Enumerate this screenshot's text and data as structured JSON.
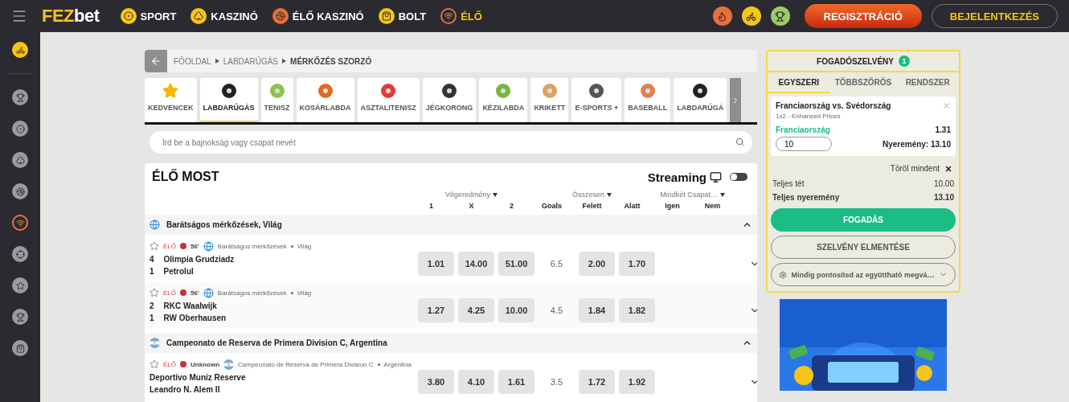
{
  "header": {
    "logo": {
      "accent": "FEZ",
      "rest": "bet"
    },
    "nav": [
      {
        "label": "SPORT",
        "selected": false
      },
      {
        "label": "KASZINÓ",
        "selected": false
      },
      {
        "label": "ÉLŐ KASZINÓ",
        "selected": false
      },
      {
        "label": "BOLT",
        "selected": false
      },
      {
        "label": "ÉLŐ",
        "selected": true
      }
    ],
    "register": "REGISZTRÁCIÓ",
    "login": "BEJELENTKEZÉS"
  },
  "sidebar": {
    "items": [
      {
        "selected": false
      },
      {
        "selected": false
      },
      {
        "selected": false
      },
      {
        "selected": false
      },
      {
        "selected": false
      },
      {
        "selected": true
      },
      {
        "selected": false
      },
      {
        "selected": false
      },
      {
        "selected": false
      },
      {
        "selected": false
      }
    ]
  },
  "breadcrumb": [
    "FŐOLDAL",
    "LABDARÚGÁS",
    "MÉRKŐZÉS SZORZÓ"
  ],
  "sports": [
    {
      "label": "KEDVENCEK",
      "selected": false
    },
    {
      "label": "LABDARÚGÁS",
      "selected": true
    },
    {
      "label": "TENISZ",
      "selected": false
    },
    {
      "label": "KOSÁRLABDA",
      "selected": false
    },
    {
      "label": "ASZTALITENISZ",
      "selected": false
    },
    {
      "label": "JÉGKORONG",
      "selected": false
    },
    {
      "label": "KÉZILABDA",
      "selected": false
    },
    {
      "label": "KRIKETT",
      "selected": false
    },
    {
      "label": "E-SPORTS +",
      "selected": false
    },
    {
      "label": "BASEBALL",
      "selected": false
    },
    {
      "label": "LABDARÚGÁ",
      "selected": false
    }
  ],
  "search": {
    "placeholder": "Írd be a bajnokság vagy csapat nevét"
  },
  "live": {
    "title": "ÉLŐ MOST",
    "streaming": {
      "label": "Streaming",
      "on": false
    },
    "markets": [
      {
        "label": "Végeredmény",
        "columns": [
          "1",
          "X",
          "2"
        ]
      },
      {
        "label": "Összesen",
        "columns": [
          "Goals",
          "Felett",
          "Alatt"
        ]
      },
      {
        "label": "Mindkét Csapat…",
        "columns": [
          "Igen",
          "Nem"
        ]
      }
    ],
    "groups": [
      {
        "league": "Barátságos mérkőzések, Világ",
        "kind": "globe",
        "expanded": true,
        "matches": [
          {
            "status": "ÉLŐ",
            "time": "56'",
            "league": "Barátságos mérkőzések",
            "country": "Világ",
            "home": {
              "score": "4",
              "name": "Olimpia Grudziadz"
            },
            "away": {
              "score": "1",
              "name": "Petrolul"
            },
            "odds": [
              "1.01",
              "14.00",
              "51.00"
            ],
            "goals": "6.5",
            "totals": [
              "2.00",
              "1.70"
            ]
          },
          {
            "status": "ÉLŐ",
            "time": "56'",
            "league": "Barátságos mérkőzések",
            "country": "Világ",
            "home": {
              "score": "2",
              "name": "RKC Waalwijk"
            },
            "away": {
              "score": "1",
              "name": "RW Oberhausen"
            },
            "odds": [
              "1.27",
              "4.25",
              "10.00"
            ],
            "goals": "4.5",
            "totals": [
              "1.84",
              "1.82"
            ]
          }
        ]
      },
      {
        "league": "Campeonato de Reserva de Primera Division C, Argentina",
        "kind": "argentina",
        "expanded": true,
        "matches": [
          {
            "status": "ÉLŐ",
            "time": "Unknown",
            "league": "Campeonato de Reserva de Primera Division C",
            "country": "Argentina",
            "home": {
              "name": "Deportivo Muniz Reserve"
            },
            "away": {
              "name": "Leandro N. Alem II"
            },
            "odds": [
              "3.80",
              "4.10",
              "1.61"
            ],
            "goals": "3.5",
            "totals": [
              "1.72",
              "1.92"
            ]
          }
        ]
      }
    ]
  },
  "betslip": {
    "title": "FOGADÓSZELVÉNY",
    "count": "1",
    "tabs": [
      {
        "label": "EGYSZERI",
        "selected": true
      },
      {
        "label": "TÖBBSZÖRÖS",
        "selected": false
      },
      {
        "label": "RENDSZER",
        "selected": false
      }
    ],
    "bet": {
      "event": "Franciaország vs. Svédország",
      "market": "1x2 - Enhanced Prices",
      "pick": "Franciaország",
      "odds": "1.31",
      "stake": "10",
      "win": "Nyeremény: 13.10"
    },
    "clear": "Töröl mindent",
    "total_stake": {
      "label": "Teljes tét",
      "value": "10.00"
    },
    "total_win": {
      "label": "Teljes nyeremény",
      "value": "13.10"
    },
    "place": "FOGADÁS",
    "save": "SZELVÉNY ELMENTÉSE",
    "accept": "Mindig pontosítsd az együttható megvá…"
  }
}
